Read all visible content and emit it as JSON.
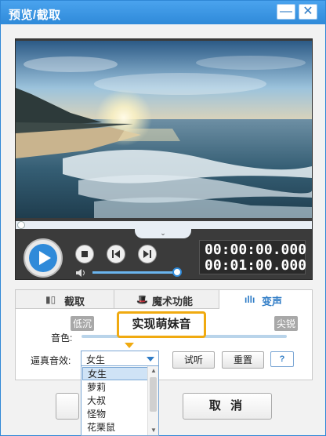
{
  "window": {
    "title": "预览/截取",
    "minimize_glyph": "—",
    "close_glyph": "✕"
  },
  "player": {
    "current_time": "00:00:00.000",
    "total_time": "00:01:00.000",
    "progress": 0.0,
    "volume": 0.95,
    "collapse_glyph": "⌄"
  },
  "tabs": [
    {
      "label": "截取",
      "icon": "crop-icon",
      "active": false
    },
    {
      "label": "魔术功能",
      "icon": "magic-hat-icon",
      "active": false
    },
    {
      "label": "变声",
      "icon": "sound-wave-icon",
      "active": true
    }
  ],
  "voice": {
    "low_label": "低沉",
    "high_label": "尖锐",
    "tone_label": "音色:",
    "effect_label": "逼真音效:",
    "selected": "女生",
    "options": [
      "女生",
      "萝莉",
      "大叔",
      "怪物",
      "花栗鼠"
    ],
    "listen_button": "试听",
    "reset_button": "重置",
    "help_button": "?"
  },
  "callout": {
    "text": "实现萌妹音"
  },
  "footer": {
    "cancel_button": "取 消"
  },
  "colors": {
    "accent": "#2f8ad9",
    "highlight": "#f0aa10"
  }
}
